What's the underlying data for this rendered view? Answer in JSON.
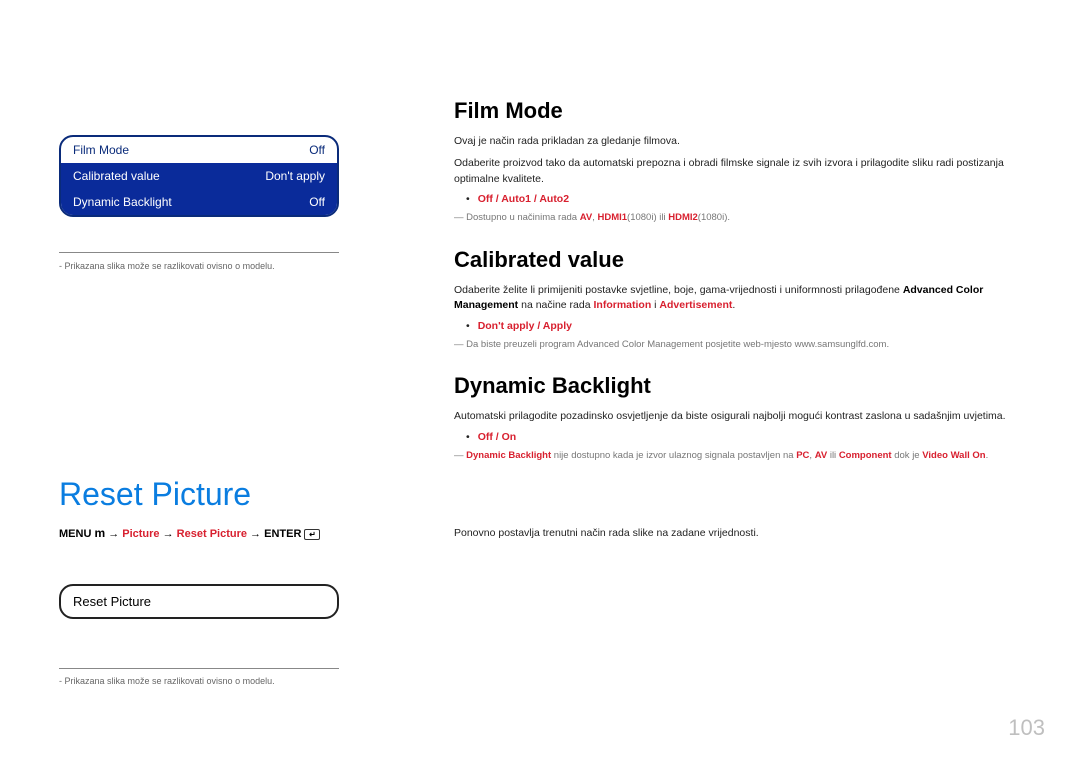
{
  "left": {
    "menu": [
      {
        "label": "Film Mode",
        "value": "Off",
        "selected": false,
        "color": "dark"
      },
      {
        "label": "Calibrated value",
        "value": "Don't apply",
        "selected": true
      },
      {
        "label": "Dynamic Backlight",
        "value": "Off",
        "selected": true
      }
    ],
    "caption": "-  Prikazana slika može se razlikovati ovisno o modelu.",
    "reset_title": "Reset Picture",
    "breadcrumb": {
      "menu": "MENU",
      "arrow": " → ",
      "picture": "Picture",
      "reset": "Reset Picture",
      "enter": "ENTER",
      "enter_symbol": "↵"
    },
    "reset_box_label": "Reset Picture",
    "caption2": "-  Prikazana slika može se razlikovati ovisno o modelu."
  },
  "right": {
    "film_mode": {
      "title": "Film Mode",
      "p1": "Ovaj je način rada prikladan za gledanje filmova.",
      "p2": "Odaberite proizvod tako da automatski prepozna i obradi filmske signale iz svih izvora i prilagodite sliku radi postizanja optimalne kvalitete.",
      "options": "Off / Auto1 / Auto2",
      "note_prefix": "― Dostupno u načinima rada ",
      "note_av": "AV",
      "note_sep1": ", ",
      "note_h1": "HDMI1",
      "note_h1sfx": "(1080i) ili ",
      "note_h2": "HDMI2",
      "note_h2sfx": "(1080i)."
    },
    "calibrated": {
      "title": "Calibrated value",
      "p1a": "Odaberite želite li primijeniti postavke svjetline, boje, gama-vrijednosti i uniformnosti prilagođene ",
      "p1b": "Advanced Color Management",
      "p1c": " na načine rada ",
      "p1d": "Information",
      "p1e": " i ",
      "p1f": "Advertisement",
      "p1g": ".",
      "options": "Don't apply / Apply",
      "note": "― Da biste preuzeli program Advanced Color Management posjetite web-mjesto www.samsunglfd.com."
    },
    "dynamic": {
      "title": "Dynamic Backlight",
      "p1": "Automatski prilagodite pozadinsko osvjetljenje da biste osigurali najbolji mogući kontrast zaslona u sadašnjim uvjetima.",
      "options": "Off / On",
      "note_a": "― ",
      "note_db": "Dynamic Backlight",
      "note_b": " nije dostupno kada je izvor ulaznog signala postavljen na ",
      "note_pc": "PC",
      "note_sep": ", ",
      "note_av": "AV",
      "note_c": " ili ",
      "note_comp": "Component",
      "note_d": " dok je ",
      "note_vw": "Video Wall On",
      "note_e": "."
    },
    "reset": {
      "p": "Ponovno postavlja trenutni način rada slike na zadane vrijednosti."
    }
  },
  "page": "103"
}
